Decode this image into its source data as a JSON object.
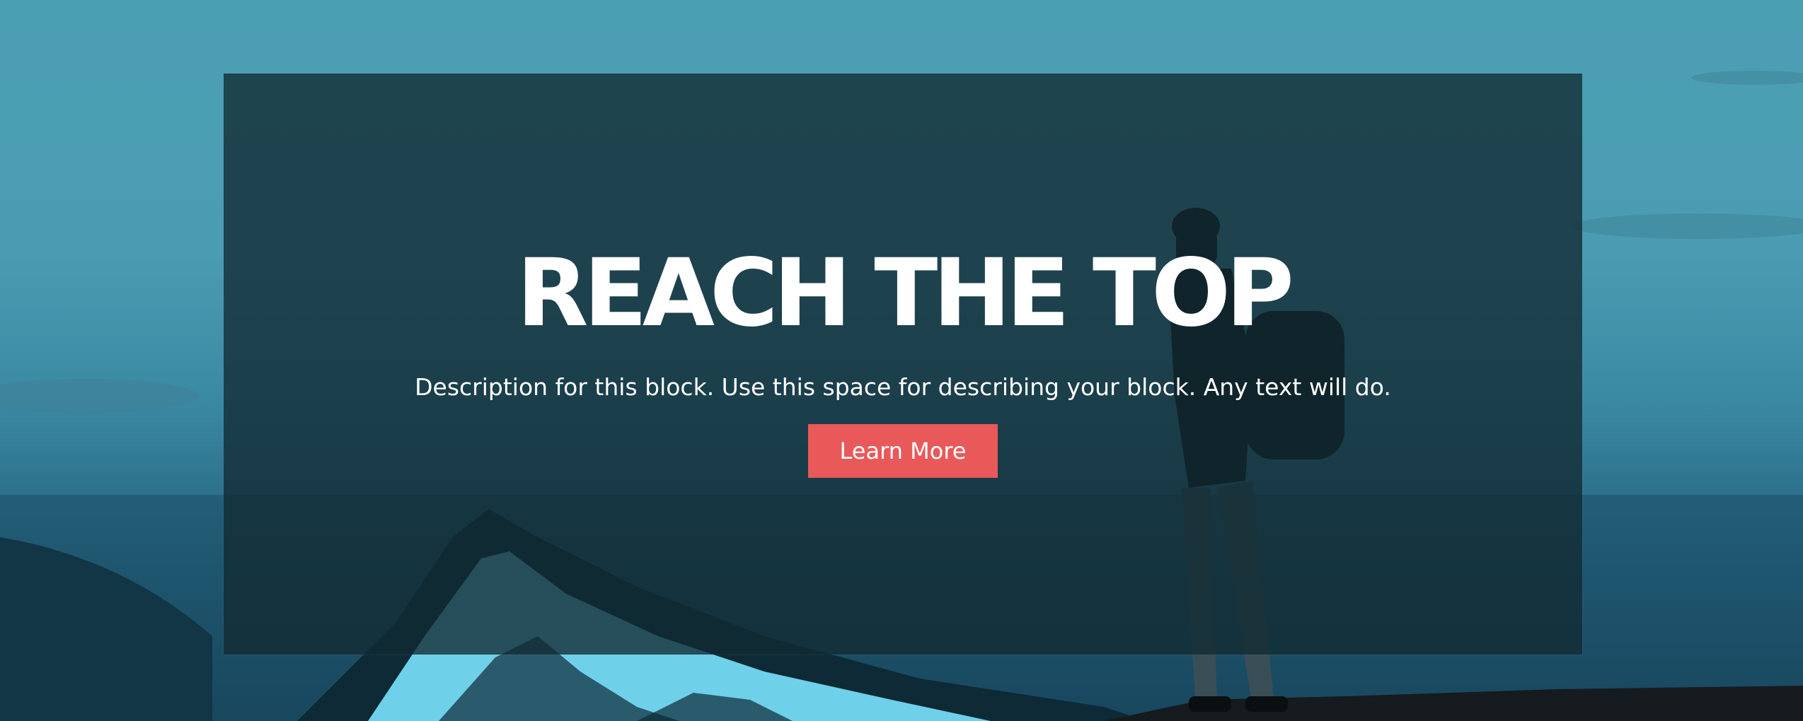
{
  "hero": {
    "title": "REACH THE TOP",
    "description": "Description for this block. Use this space for describing your block. Any text will do.",
    "button_label": "Learn More"
  },
  "colors": {
    "sky": "#4b9fb3",
    "overlay": "#122a32",
    "button": "#e9595a",
    "text": "#ffffff"
  }
}
